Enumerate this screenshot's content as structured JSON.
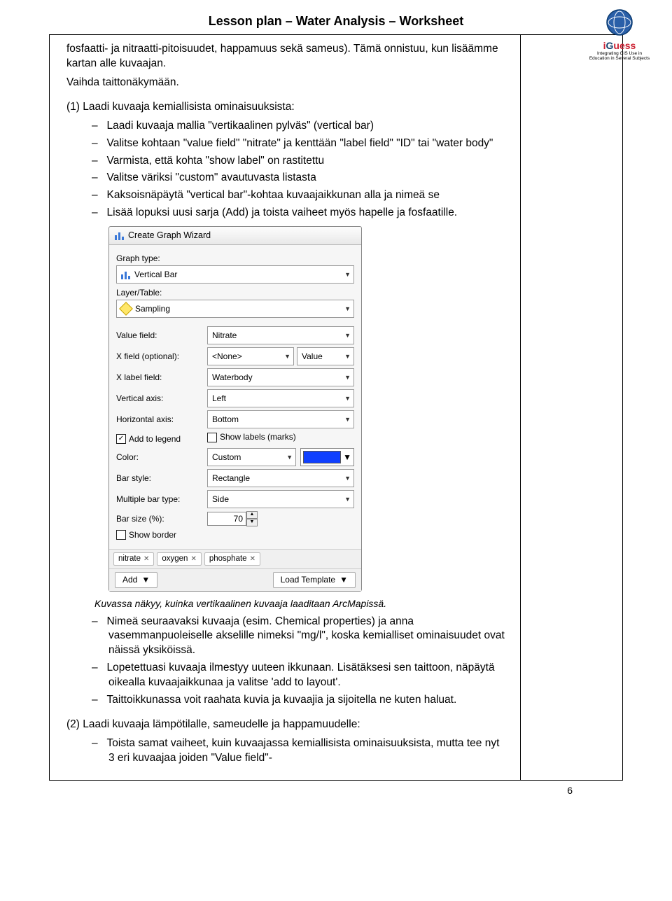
{
  "header": {
    "title": "Lesson plan – Water Analysis – Worksheet",
    "logo_name": "iGuess",
    "logo_tagline": "Integrating GIS Use in Education in Several Subjects"
  },
  "intro": {
    "p1": "fosfaatti- ja nitraatti-pitoisuudet, happamuus sekä sameus). Tämä onnistuu, kun lisäämme kartan alle kuvaajan.",
    "p2": "Vaihda taittonäkymään.",
    "p3": "(1) Laadi kuvaaja kemiallisista ominaisuuksista:"
  },
  "list_a": [
    "Laadi kuvaaja mallia \"vertikaalinen pylväs\" (vertical bar)",
    "Valitse kohtaan \"value field\" \"nitrate\" ja kenttään \"label field\" \"ID\" tai \"water body\"",
    "Varmista, että kohta \"show label\" on rastitettu",
    "Valitse väriksi \"custom\" avautuvasta listasta",
    "Kaksoisnäpäytä \"vertical bar\"-kohtaa kuvaajaikkunan alla ja nimeä se",
    "Lisää lopuksi uusi sarja (Add) ja toista vaiheet myös hapelle ja fosfaatille."
  ],
  "wizard": {
    "title": "Create Graph Wizard",
    "graph_type_label": "Graph type:",
    "graph_type_value": "Vertical Bar",
    "layer_label": "Layer/Table:",
    "layer_value": "Sampling",
    "rows": {
      "value_field": {
        "label": "Value field:",
        "value": "Nitrate"
      },
      "x_field": {
        "label": "X field (optional):",
        "value": "<None>",
        "value2": "Value"
      },
      "x_label_field": {
        "label": "X label field:",
        "value": "Waterbody"
      },
      "vertical_axis": {
        "label": "Vertical axis:",
        "value": "Left"
      },
      "horizontal_axis": {
        "label": "Horizontal axis:",
        "value": "Bottom"
      },
      "add_legend": "Add to legend",
      "show_labels": "Show labels (marks)",
      "color": {
        "label": "Color:",
        "value": "Custom"
      },
      "bar_style": {
        "label": "Bar style:",
        "value": "Rectangle"
      },
      "multi_bar": {
        "label": "Multiple bar type:",
        "value": "Side"
      },
      "bar_size": {
        "label": "Bar size (%):",
        "value": "70"
      },
      "show_border": "Show border"
    },
    "tabs": [
      "nitrate",
      "oxygen",
      "phosphate"
    ],
    "footer": {
      "add": "Add",
      "load": "Load Template"
    }
  },
  "caption": "Kuvassa näkyy, kuinka vertikaalinen kuvaaja laaditaan ArcMapissä.",
  "list_b": [
    "Nimeä seuraavaksi kuvaaja (esim. Chemical properties) ja anna vasemmanpuoleiselle akselille nimeksi \"mg/l\", koska kemialliset ominaisuudet ovat näissä yksiköissä.",
    "Lopetettuasi kuvaaja ilmestyy uuteen ikkunaan. Lisätäksesi sen taittoon, näpäytä oikealla kuvaajaikkunaa ja valitse 'add to layout'.",
    "Taittoikkunassa voit raahata kuvia ja kuvaajia ja sijoitella ne kuten haluat."
  ],
  "outro": {
    "p1": "(2) Laadi kuvaaja lämpötilalle, sameudelle ja happamuudelle:",
    "li": "Toista samat vaiheet, kuin kuvaajassa kemiallisista ominaisuuksista, mutta tee nyt 3 eri kuvaajaa joiden \"Value field\"-"
  },
  "page_number": "6"
}
